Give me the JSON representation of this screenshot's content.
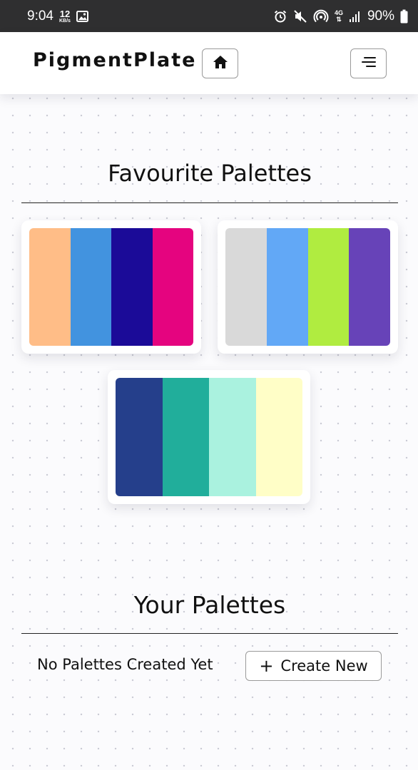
{
  "status_bar": {
    "time": "9:04",
    "speed_value": "12",
    "speed_unit": "KB/s",
    "network_type": "4G",
    "battery": "90%"
  },
  "navbar": {
    "brand": "PigmentPlate",
    "home_icon": "home-icon",
    "menu_icon": "menu-icon"
  },
  "favourites": {
    "title": "Favourite Palettes",
    "palettes": [
      {
        "colors": [
          "#ffbd87",
          "#4293df",
          "#1b0b98",
          "#e5047f"
        ]
      },
      {
        "colors": [
          "#d9d9d9",
          "#62a8f6",
          "#b0ec40",
          "#6743b8"
        ]
      },
      {
        "colors": [
          "#253f8b",
          "#21ae9b",
          "#aaf2df",
          "#fffec7"
        ]
      }
    ]
  },
  "your_palettes": {
    "title": "Your Palettes",
    "empty_message": "No Palettes Created Yet",
    "create_label": "Create New",
    "create_icon": "plus-icon"
  },
  "colors": {
    "status_bar_bg": "#2f2f30",
    "navbar_bg": "#ffffff",
    "page_bg": "#fbfbfd",
    "dot": "#c9cad3"
  }
}
